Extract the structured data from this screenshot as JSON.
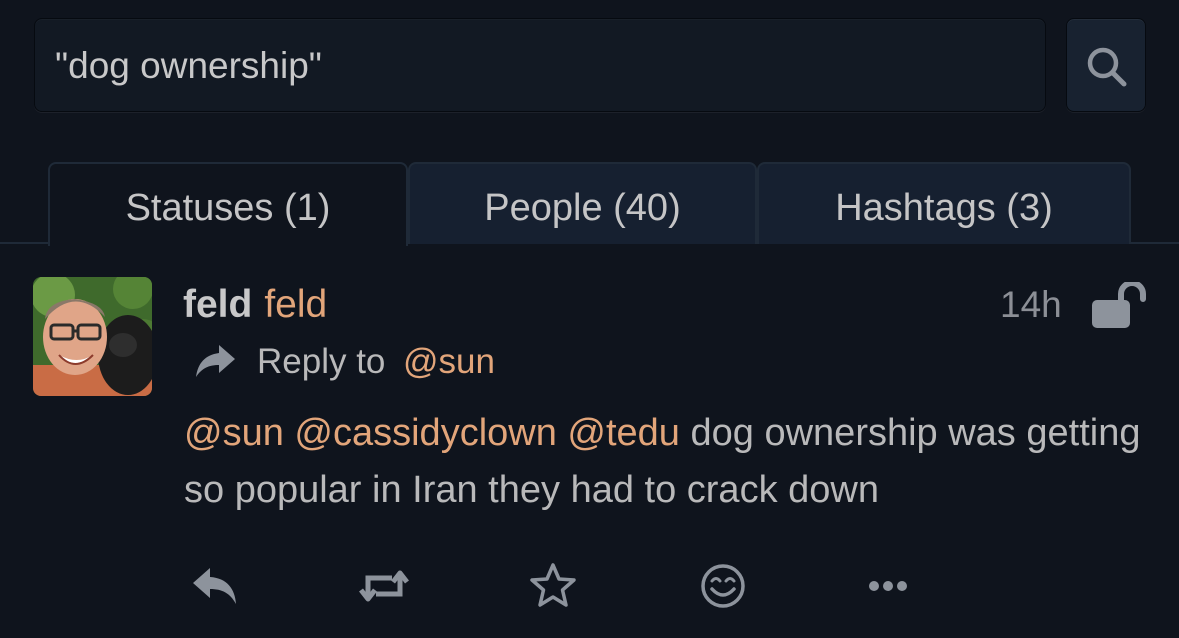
{
  "search": {
    "query": "\"dog ownership\"",
    "button_icon": "search-icon"
  },
  "tabs": [
    {
      "label": "Statuses (1)",
      "active": true
    },
    {
      "label": "People (40)",
      "active": false
    },
    {
      "label": "Hashtags (3)",
      "active": false
    }
  ],
  "status": {
    "avatar": "avatar",
    "display_name": "feld",
    "account_name": "feld",
    "time": "14h",
    "visibility_icon": "unlock-icon",
    "reply_to": {
      "label": "Reply to",
      "mention": "@sun"
    },
    "content": {
      "mentions": [
        "@sun",
        "@cassidyclown",
        "@tedu"
      ],
      "text": " dog ownership was getting so popular in Iran they had to crack down"
    },
    "actions": [
      "reply-icon",
      "repeat-icon",
      "favorite-icon",
      "emoji-react-icon",
      "more-icon"
    ]
  },
  "colors": {
    "background": "#0f141d",
    "text": "#b9b9ba",
    "link": "#e2a57a",
    "muted": "#8c8f96"
  }
}
